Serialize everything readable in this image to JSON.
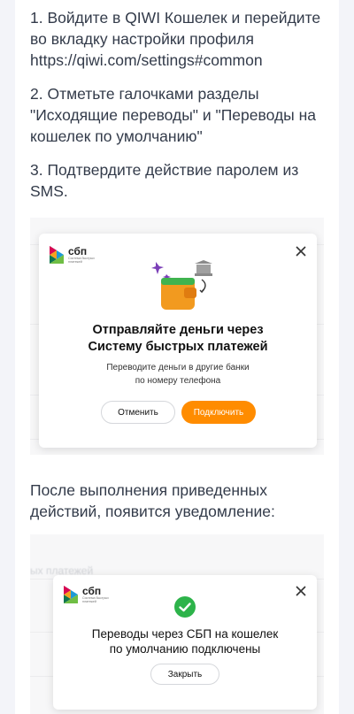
{
  "colors": {
    "accent": "#ff8c00",
    "success": "#2db34a",
    "text": "#333b4a",
    "star": "#7b3fb8"
  },
  "steps": [
    "1. Войдите в QIWI Кошелек и перейдите во вкладку настройки профиля https://qiwi.com/settings#common",
    "2. Отметьте галочками разделы \"Исходящие переводы\" и \"Переводы на кошелек по умолчанию\"",
    "3. Подтвердите действие паролем из SMS."
  ],
  "after_text": "После выполнения приведенных действий, появится уведомление:",
  "modal1": {
    "logo_name": "сбп",
    "logo_sub": "Система быстрых платежей",
    "title": "Отправляйте деньги через\nСистему быстрых платежей",
    "subtitle": "Переводите деньги в другие банки\nпо номеру телефона",
    "cancel_label": "Отменить",
    "connect_label": "Подключить",
    "close_icon": "close-icon"
  },
  "modal2": {
    "logo_name": "сбп",
    "logo_sub": "Система быстрых платежей",
    "title": "Переводы через СБП на кошелек\nпо умолчанию подключены",
    "close_label": "Закрыть",
    "close_icon": "close-icon"
  },
  "background_text": "ых платежей"
}
